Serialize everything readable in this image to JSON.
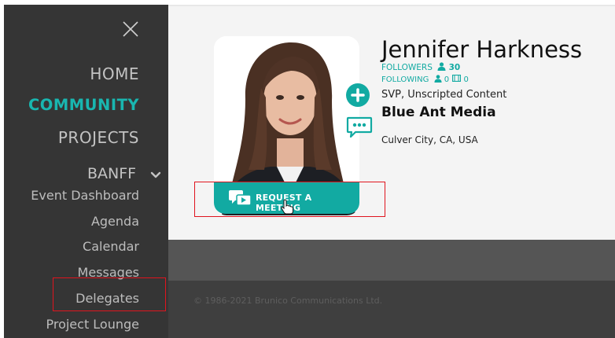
{
  "sidebar": {
    "nav": {
      "home": "HOME",
      "community": "COMMUNITY",
      "projects": "PROJECTS",
      "banff": "BANFF"
    },
    "submenu": {
      "event_dashboard": "Event Dashboard",
      "agenda": "Agenda",
      "calendar": "Calendar",
      "messages": "Messages",
      "delegates": "Delegates",
      "project_lounge": "Project Lounge"
    },
    "active_item": "COMMUNITY",
    "icons": {
      "close": "close-icon",
      "expand": "chevron-down-icon"
    }
  },
  "profile": {
    "name": "Jennifer Harkness",
    "followers_label": "FOLLOWERS",
    "followers_count": "30",
    "following_label": "FOLLOWING",
    "following_people": "0",
    "following_projects": "0",
    "title": "SVP, Unscripted Content",
    "company": "Blue Ant Media",
    "location": "Culver City, CA, USA",
    "request_meeting_label": "REQUEST A MEETING"
  },
  "footer": {
    "copyright": "© 1986-2021 Brunico Communications Ltd."
  },
  "colors": {
    "accent": "#12aaa2",
    "sidebar_bg": "#353535",
    "highlight_box": "#e0141e"
  }
}
